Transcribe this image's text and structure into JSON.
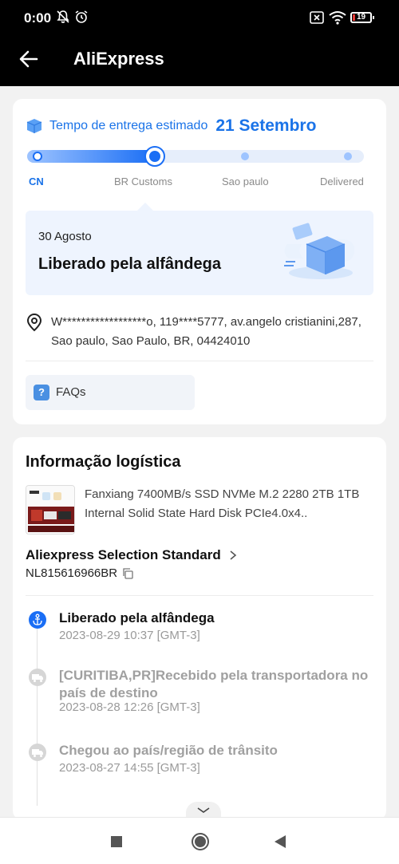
{
  "status_bar": {
    "time": "0:00",
    "battery": "19",
    "icons": [
      "silent-bell-icon",
      "alarm-icon",
      "sim-off-icon",
      "wifi-icon",
      "battery-icon"
    ]
  },
  "header": {
    "title": "AliExpress",
    "back_icon": "arrow-left-icon"
  },
  "delivery": {
    "eta_label": "Tempo de entrega estimado",
    "eta_date": "21 Setembro",
    "stages": [
      "CN",
      "BR Customs",
      "Sao paulo",
      "Delivered"
    ],
    "current_stage": "BR Customs",
    "accent": "#1a73e8"
  },
  "latest_status": {
    "date": "30 Agosto",
    "title": "Liberado pela alfândega"
  },
  "address": {
    "text": "W******************o,  119****5777,  av.angelo cristianini,287,  Sao paulo,  Sao Paulo,  BR,  04424010"
  },
  "faq": {
    "label": "FAQs"
  },
  "logistics": {
    "title": "Informação logística",
    "product_name": "Fanxiang 7400MB/s SSD NVMe M.2 2280 2TB 1TB Internal Solid State Hard Disk PCIe4.0x4..",
    "carrier": "Aliexpress Selection Standard",
    "tracking_number": "NL815616966BR",
    "events": [
      {
        "title": "Liberado pela alfândega",
        "time": "2023-08-29 10:37 [GMT-3]",
        "active": true,
        "icon": "anchor-icon"
      },
      {
        "title": "[CURITIBA,PR]Recebido pela transportadora no país de destino",
        "time": "2023-08-28 12:26 [GMT-3]",
        "active": false,
        "icon": "truck-icon"
      },
      {
        "title": "Chegou ao país/região de trânsito",
        "time": "2023-08-27 14:55 [GMT-3]",
        "active": false,
        "icon": "truck-icon"
      }
    ]
  },
  "nav": {
    "buttons": [
      "recent-apps-icon",
      "home-icon",
      "back-icon"
    ]
  }
}
